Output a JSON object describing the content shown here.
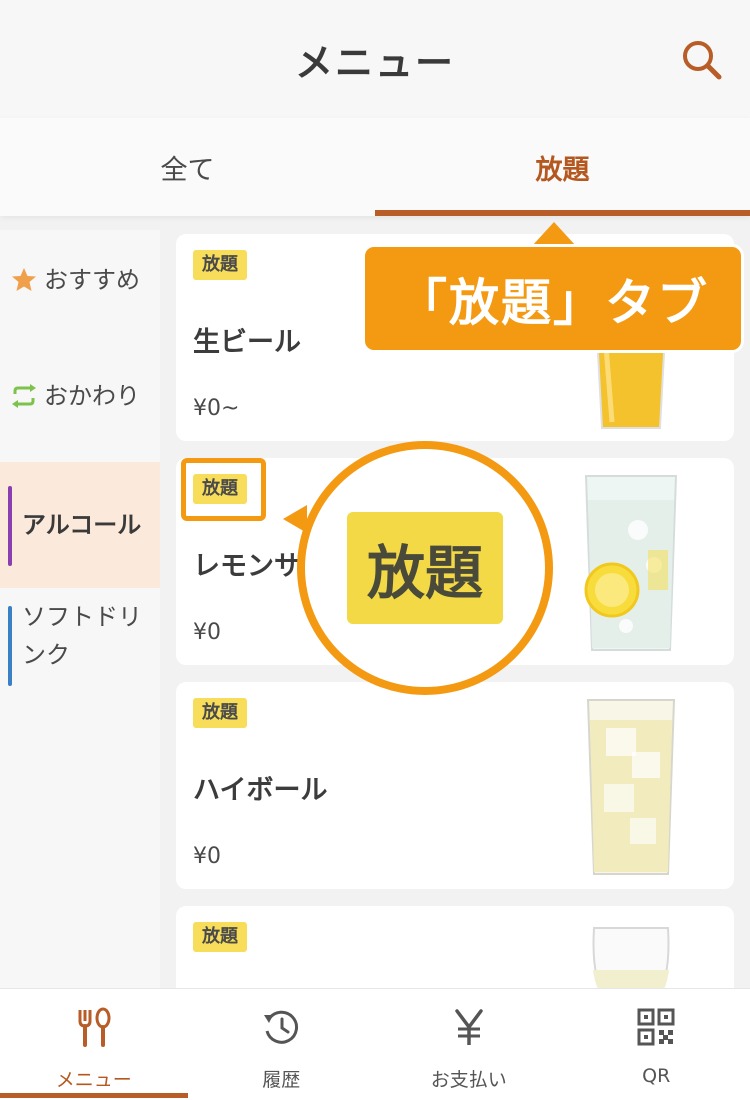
{
  "header": {
    "title": "メニュー",
    "search_icon": "search-icon"
  },
  "tabs": [
    {
      "label": "全て",
      "active": false
    },
    {
      "label": "放題",
      "active": true
    }
  ],
  "sidebar": {
    "items": [
      {
        "label": "おすすめ",
        "icon": "star-icon",
        "icon_color": "#f0a04b"
      },
      {
        "label": "おかわり",
        "icon": "repeat-icon",
        "icon_color": "#7dc24a"
      },
      {
        "label": "アルコール",
        "active": true,
        "bar_color": "#8a3fb0"
      },
      {
        "label": "ソフトドリンク",
        "bar_color": "#3b7fc4"
      }
    ]
  },
  "menu_items": [
    {
      "badge": "放題",
      "name": "生ビール",
      "price": "¥0~",
      "image": "beer-glass"
    },
    {
      "badge": "放題",
      "name": "レモンサ",
      "price": "¥0",
      "image": "lemon-sour-glass"
    },
    {
      "badge": "放題",
      "name": "ハイボール",
      "price": "¥0",
      "image": "highball-glass"
    },
    {
      "badge": "放題",
      "name": "",
      "price": "",
      "image": "wine-glass"
    }
  ],
  "callout": {
    "text": "「放題」タブ",
    "magnified_badge": "放題"
  },
  "bottom_nav": [
    {
      "label": "メニュー",
      "icon": "fork-spoon-icon",
      "active": true
    },
    {
      "label": "履歴",
      "icon": "history-icon"
    },
    {
      "label": "お支払い",
      "icon": "yen-icon"
    },
    {
      "label": "QR",
      "icon": "qr-code-icon"
    }
  ],
  "colors": {
    "accent": "#b85d28",
    "callout": "#f39a12",
    "badge": "#f7dd5a",
    "active_side_bg": "#fbeadb"
  }
}
